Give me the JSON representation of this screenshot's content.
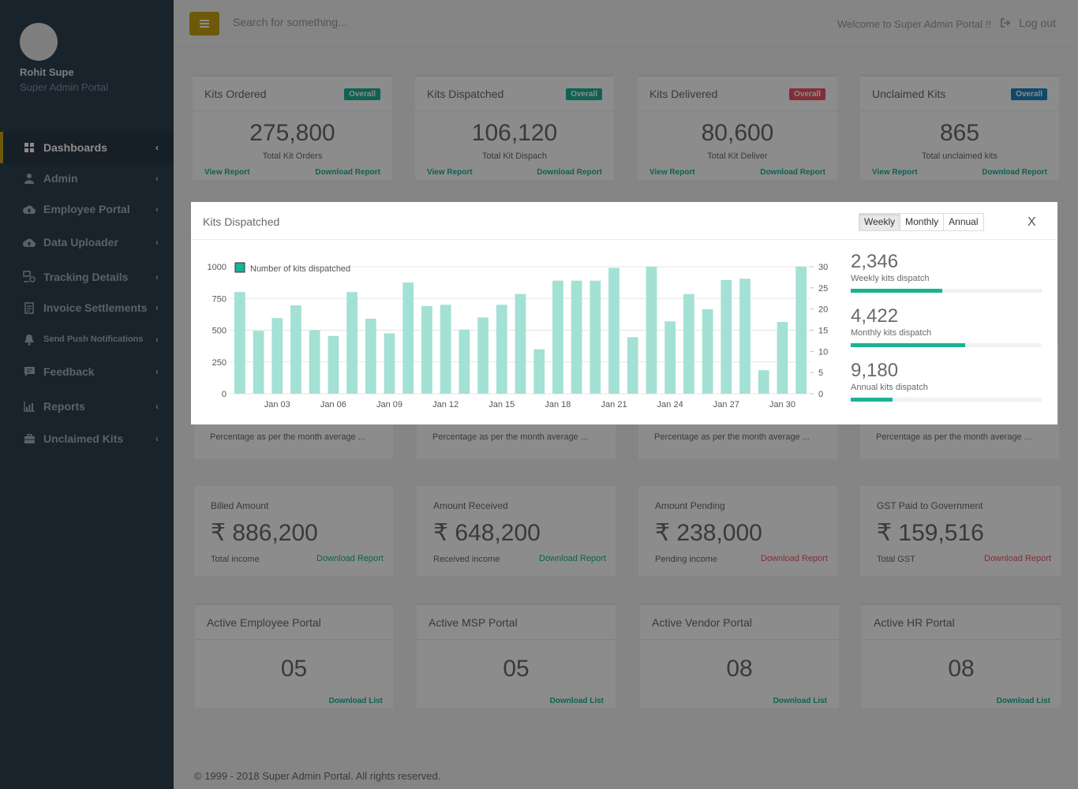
{
  "sidebar": {
    "user_name": "Rohit Supe",
    "user_role": "Super Admin Portal",
    "items": [
      {
        "label": "Dashboards",
        "icon": "dashboard-icon"
      },
      {
        "label": "Admin",
        "icon": "user-icon"
      },
      {
        "label": "Employee Portal",
        "icon": "cloud-upload-icon"
      },
      {
        "label": "Data Uploader",
        "icon": "cloud-upload-icon"
      },
      {
        "label": "Tracking Details",
        "icon": "tracking-icon"
      },
      {
        "label": "Invoice Settlements",
        "icon": "invoice-icon"
      },
      {
        "label": "Send Push Notifications",
        "icon": "bell-icon"
      },
      {
        "label": "Feedback",
        "icon": "comment-icon"
      },
      {
        "label": "Reports",
        "icon": "chart-icon"
      },
      {
        "label": "Unclaimed Kits",
        "icon": "briefcase-icon"
      }
    ]
  },
  "topbar": {
    "search_placeholder": "Search for something...",
    "welcome": "Welcome to Super Admin Portal !!",
    "logout": "Log out"
  },
  "kit_cards": [
    {
      "title": "Kits Ordered",
      "badge": "Overall",
      "badge_color": "#1ab394",
      "value": "275,800",
      "label": "Total Kit Orders",
      "view": "View Report",
      "download": "Download Report"
    },
    {
      "title": "Kits Dispatched",
      "badge": "Overall",
      "badge_color": "#1ab394",
      "value": "106,120",
      "label": "Total Kit Dispach",
      "view": "View Report",
      "download": "Download Report"
    },
    {
      "title": "Kits Delivered",
      "badge": "Overall",
      "badge_color": "#ed5565",
      "value": "80,600",
      "label": "Total Kit Deliver",
      "view": "View Report",
      "download": "Download Report"
    },
    {
      "title": "Unclaimed Kits",
      "badge": "Overall",
      "badge_color": "#1c84c6",
      "value": "865",
      "label": "Total unclaimed kits",
      "view": "View Report",
      "download": "Download Report"
    }
  ],
  "notes": [
    "Percentage as per the month average ...",
    "Percentage as per the month average ...",
    "Percentage as per the month average ...",
    "Percentage as per the month average ..."
  ],
  "amount_cards": [
    {
      "title": "Billed Amount",
      "value": "₹ 886,200",
      "label": "Total income",
      "link": "Download Report",
      "link_color": "#1ab394"
    },
    {
      "title": "Amount Received",
      "value": "₹ 648,200",
      "label": "Received income",
      "link": "Download Report",
      "link_color": "#1ab394"
    },
    {
      "title": "Amount Pending",
      "value": "₹ 238,000",
      "label": "Pending income",
      "link": "Download Report",
      "link_color": "#ed5565"
    },
    {
      "title": "GST Paid to Government",
      "value": "₹ 159,516",
      "label": "Total GST",
      "link": "Download Report",
      "link_color": "#ed5565"
    }
  ],
  "portal_cards": [
    {
      "title": "Active Employee Portal",
      "value": "05",
      "link": "Download List"
    },
    {
      "title": "Active MSP Portal",
      "value": "05",
      "link": "Download List"
    },
    {
      "title": "Active Vendor Portal",
      "value": "08",
      "link": "Download List"
    },
    {
      "title": "Active HR Portal",
      "value": "08",
      "link": "Download List"
    }
  ],
  "footer": "© 1999 - 2018 Super Admin Portal.  All rights reserved.",
  "modal": {
    "title": "Kits Dispatched",
    "tabs": [
      "Weekly",
      "Monthly",
      "Annual"
    ],
    "active_tab": "Weekly",
    "close": "X",
    "stats": [
      {
        "value": "2,346",
        "label": "Weekly kits dispatch",
        "progress": 0.48
      },
      {
        "value": "4,422",
        "label": "Monthly kits dispatch",
        "progress": 0.6
      },
      {
        "value": "9,180",
        "label": "Annual kits dispatch",
        "progress": 0.22
      }
    ]
  },
  "chart_data": {
    "type": "bar",
    "series": [
      {
        "name": "Number of kits dispatched",
        "color": "#a3e1d4",
        "legend_color": "#1ab394",
        "values": [
          800,
          495,
          595,
          695,
          500,
          455,
          800,
          590,
          475,
          875,
          690,
          700,
          505,
          600,
          700,
          785,
          350,
          890,
          890,
          890,
          990,
          445,
          1000,
          570,
          785,
          665,
          895,
          905,
          185,
          565,
          1000
        ]
      }
    ],
    "x_tick_labels": [
      "Jan 03",
      "Jan 06",
      "Jan 09",
      "Jan 12",
      "Jan 15",
      "Jan 18",
      "Jan 21",
      "Jan 24",
      "Jan 27",
      "Jan 30"
    ],
    "x_tick_indices": [
      2,
      5,
      8,
      11,
      14,
      17,
      20,
      23,
      26,
      29
    ],
    "y_left_ticks": [
      0,
      250,
      500,
      750,
      1000
    ],
    "y_right_ticks": [
      0,
      5,
      10,
      15,
      20,
      25,
      30
    ],
    "ylim": [
      0,
      1000
    ],
    "y2lim": [
      0,
      30
    ],
    "grid": true,
    "legend": "top-left"
  }
}
